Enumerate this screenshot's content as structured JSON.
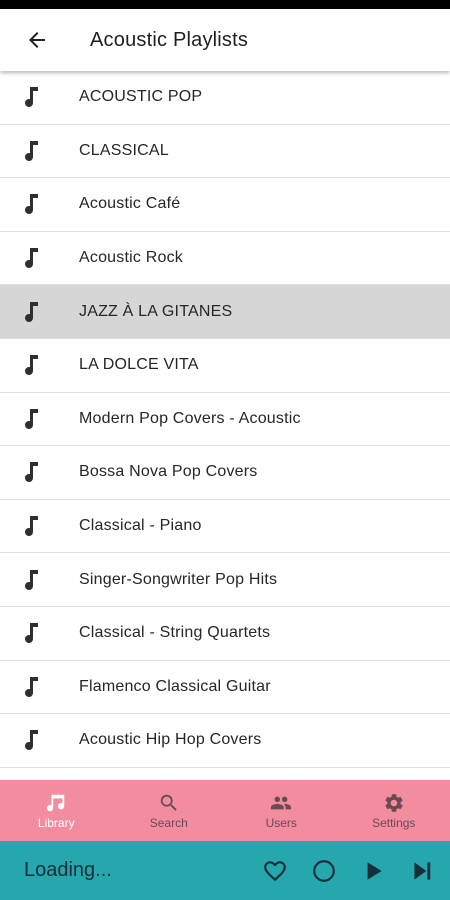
{
  "app_bar": {
    "title": "Acoustic Playlists",
    "back_icon": "arrow-back-icon"
  },
  "playlists": [
    {
      "label": "ACOUSTIC POP"
    },
    {
      "label": "CLASSICAL"
    },
    {
      "label": "Acoustic Café"
    },
    {
      "label": "Acoustic Rock"
    },
    {
      "label": "JAZZ À LA GITANES",
      "selected": true
    },
    {
      "label": "LA DOLCE VITA"
    },
    {
      "label": "Modern Pop Covers - Acoustic"
    },
    {
      "label": "Bossa Nova Pop Covers"
    },
    {
      "label": "Classical - Piano"
    },
    {
      "label": "Singer-Songwriter Pop Hits"
    },
    {
      "label": "Classical - String Quartets"
    },
    {
      "label": "Flamenco Classical Guitar"
    },
    {
      "label": "Acoustic Hip Hop Covers"
    }
  ],
  "bottom_nav": {
    "items": [
      {
        "label": "Library",
        "icon": "music-note-icon",
        "active": true
      },
      {
        "label": "Search",
        "icon": "search-icon"
      },
      {
        "label": "Users",
        "icon": "people-icon"
      },
      {
        "label": "Settings",
        "icon": "gear-icon"
      }
    ]
  },
  "player": {
    "status": "Loading...",
    "controls": [
      "heart-icon",
      "circle-icon",
      "play-icon",
      "skip-next-icon"
    ]
  },
  "colors": {
    "nav_bg": "#f28da0",
    "player_bg": "#26a6ad",
    "selected_row": "#d6d6d6"
  }
}
